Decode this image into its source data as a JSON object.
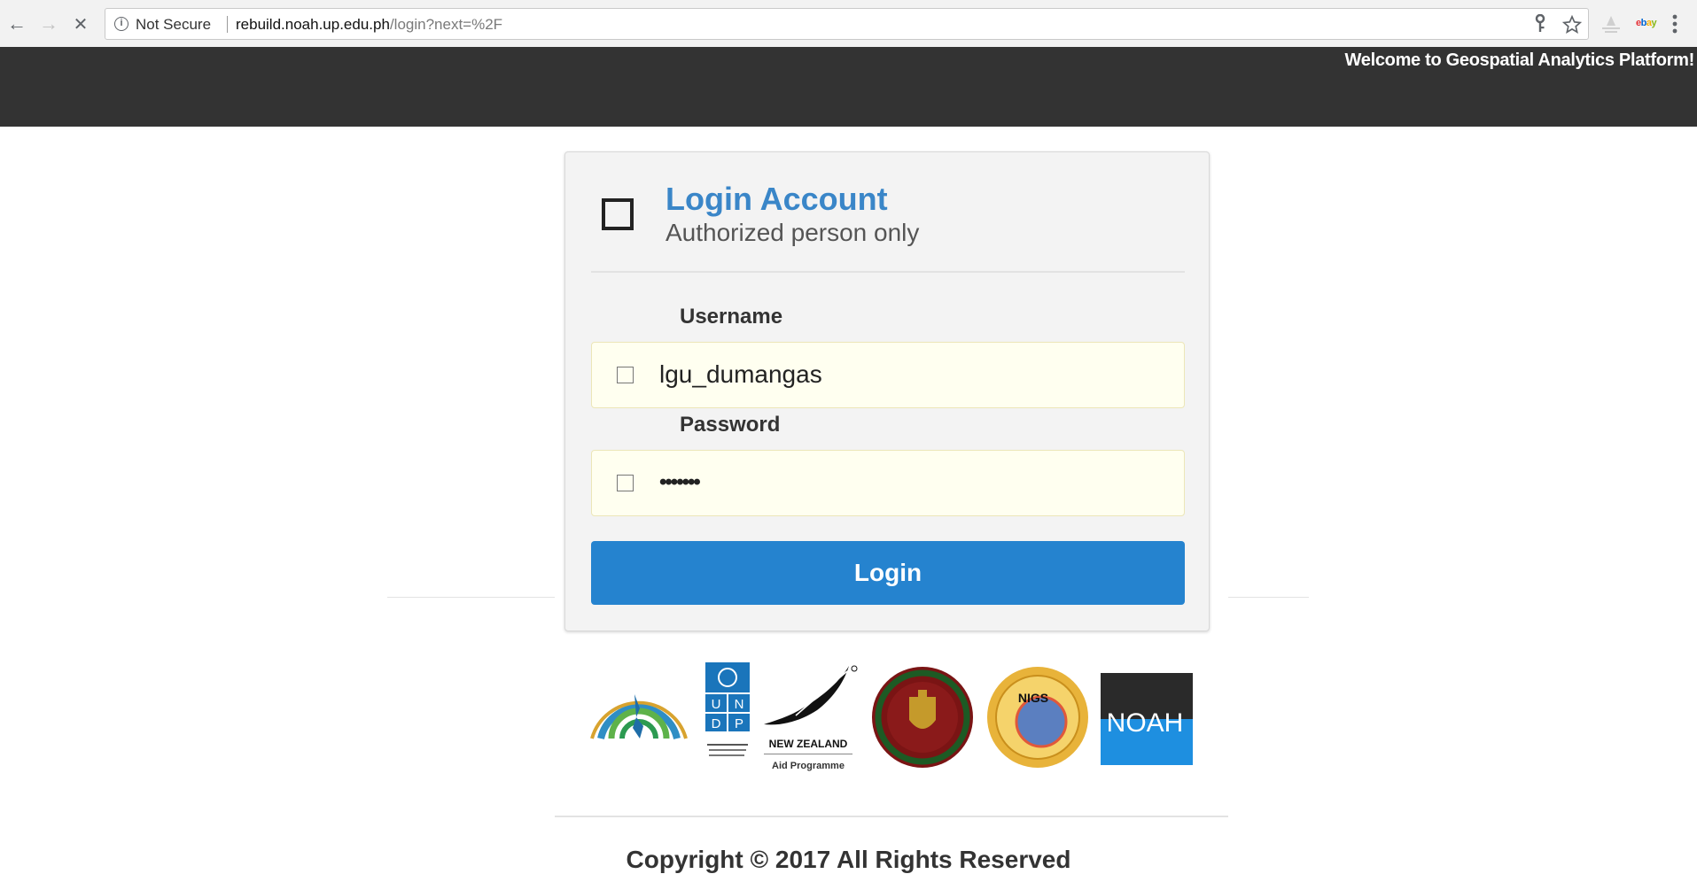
{
  "browser": {
    "back_icon": "←",
    "forward_icon": "→",
    "stop_icon": "✕",
    "security_label": "Not Secure",
    "url_domain": "rebuild.noah.up.edu.ph",
    "url_path": "/login?next=%2F",
    "extensions": [
      "key-icon",
      "star-icon",
      "extension-icon",
      "ebay-icon",
      "menu-icon"
    ]
  },
  "header": {
    "welcome_text": "Welcome to Geospatial Analytics Platform!"
  },
  "login": {
    "title": "Login Account",
    "subtitle": "Authorized person only",
    "username_label": "Username",
    "username_value": "lgu_dumangas",
    "password_label": "Password",
    "password_value": "•••••••",
    "submit_label": "Login"
  },
  "partners": {
    "logos": [
      "climate-change-commission-logo",
      "undp-logo",
      "new-zealand-aid-logo",
      "up-seal-logo",
      "nigs-logo",
      "noah-logo"
    ],
    "undp_letters": [
      "U",
      "N",
      "D",
      "P"
    ],
    "nz_line1": "NEW ZEALAND",
    "nz_line2": "Aid Programme",
    "nigs_text": "NIGS",
    "noah_text": "NOAH"
  },
  "footer": {
    "copyright": "Copyright © 2017 All Rights Reserved"
  },
  "colors": {
    "header_bg": "#333333",
    "accent_blue": "#3a86c8",
    "button_blue": "#2583cf",
    "input_bg": "#fffff0"
  }
}
